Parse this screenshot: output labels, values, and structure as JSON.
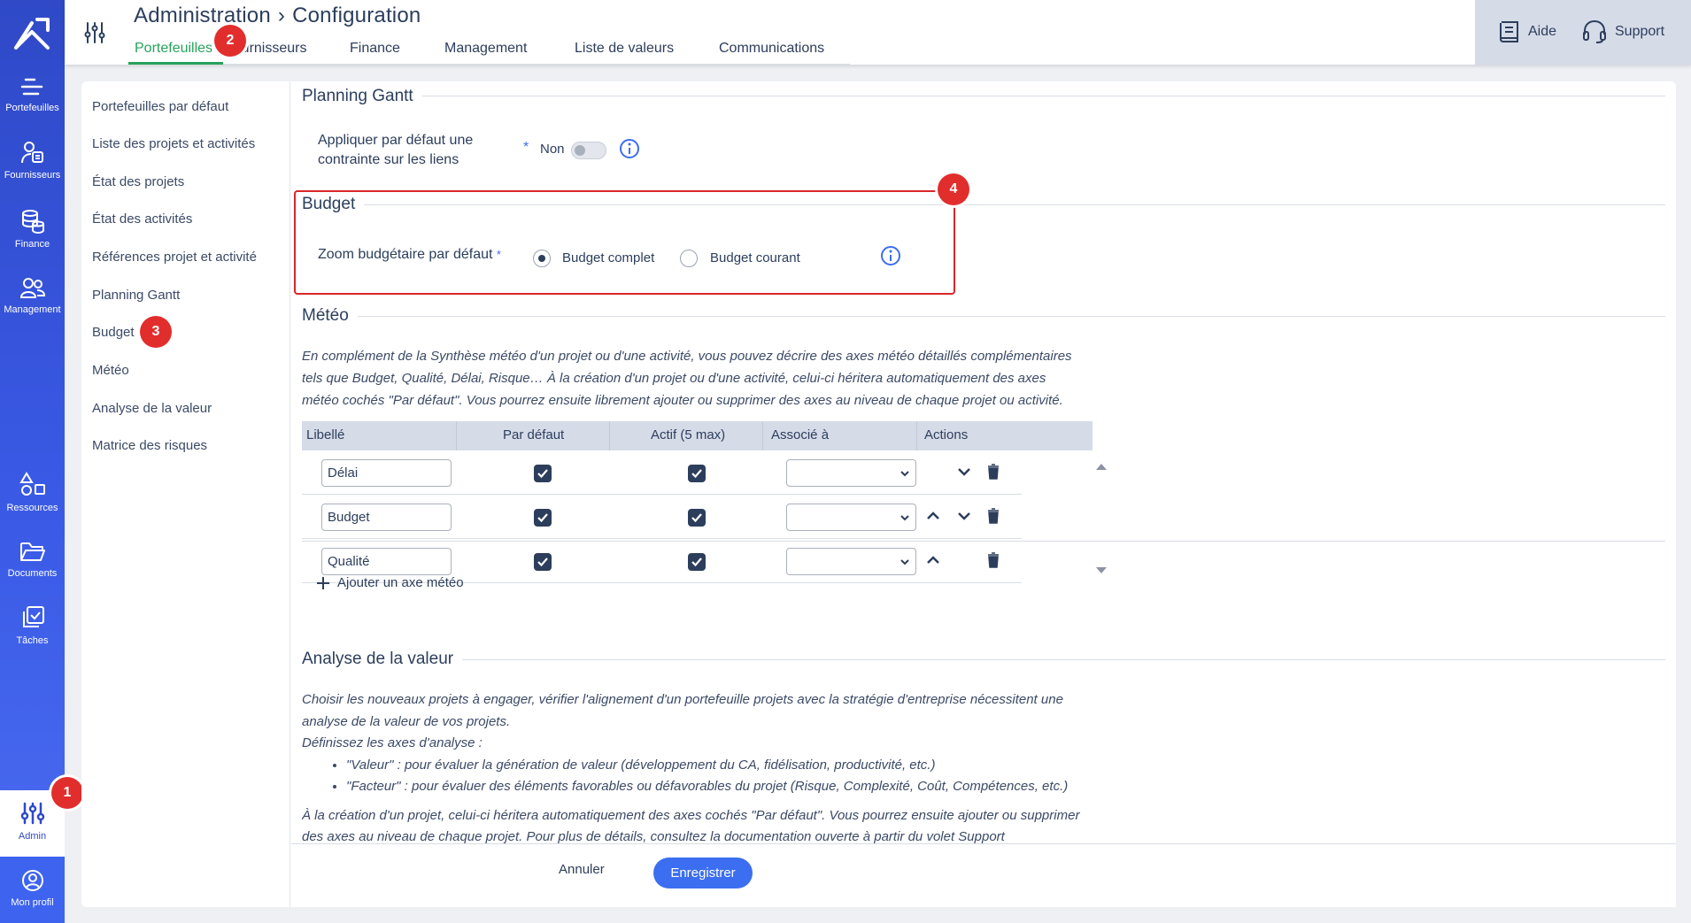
{
  "nav": {
    "items": [
      {
        "label": "Portefeuilles",
        "icon": "portfolio-icon"
      },
      {
        "label": "Fournisseurs",
        "icon": "suppliers-icon"
      },
      {
        "label": "Finance",
        "icon": "finance-icon"
      },
      {
        "label": "Management",
        "icon": "management-icon"
      },
      {
        "label": "Ressources",
        "icon": "resources-icon"
      },
      {
        "label": "Documents",
        "icon": "documents-icon"
      },
      {
        "label": "Tâches",
        "icon": "tasks-icon"
      }
    ],
    "admin_label": "Admin",
    "profile_label": "Mon profil"
  },
  "header": {
    "crumb_root": "Administration",
    "crumb_sep": "›",
    "crumb_current": "Configuration",
    "tabs": [
      "Portefeuilles",
      "Fournisseurs",
      "Finance",
      "Management",
      "Liste de valeurs",
      "Communications"
    ],
    "active_tab": "Portefeuilles",
    "help_label": "Aide",
    "support_label": "Support"
  },
  "subnav": {
    "items": [
      "Portefeuilles par défaut",
      "Liste des projets et activités",
      "État des projets",
      "État des activités",
      "Références projet et activité",
      "Planning Gantt",
      "Budget",
      "Météo",
      "Analyse de la valeur",
      "Matrice des risques"
    ],
    "selected": "Budget"
  },
  "gantt": {
    "title": "Planning Gantt",
    "label_line1": "Appliquer par défaut une",
    "label_line2": "contrainte sur les liens",
    "required_mark": "*",
    "toggle_label": "Non"
  },
  "budget": {
    "title": "Budget",
    "label": "Zoom budgétaire par défaut",
    "required_mark": "*",
    "option_full": "Budget complet",
    "option_current": "Budget courant",
    "selected": "Budget complet"
  },
  "meteo": {
    "title": "Météo",
    "desc_line1": "En complément de la Synthèse météo d'un projet ou d'une activité, vous pouvez décrire des axes météo détaillés complémentaires",
    "desc_line2": "tels que Budget, Qualité, Délai, Risque… À la création d'un projet ou d'une activité, celui-ci héritera automatiquement des axes",
    "desc_line3": "météo cochés \"Par défaut\". Vous pourrez ensuite librement ajouter ou supprimer des axes au niveau de chaque projet ou activité.",
    "columns": [
      "Libellé",
      "Par défaut",
      "Actif (5 max)",
      "Associé à",
      "Actions"
    ],
    "rows": [
      {
        "label": "Délai",
        "default": true,
        "active": true,
        "associated": ""
      },
      {
        "label": "Budget",
        "default": true,
        "active": true,
        "associated": ""
      },
      {
        "label": "Qualité",
        "default": true,
        "active": true,
        "associated": ""
      }
    ],
    "add_label": "Ajouter un axe météo"
  },
  "value_analysis": {
    "title": "Analyse de la valeur",
    "desc_line1": "Choisir les nouveaux projets à engager, vérifier l'alignement d'un portefeuille projets avec la stratégie d'entreprise nécessitent une",
    "desc_line2": "analyse de la valeur de vos projets.",
    "desc_line3": "Définissez les axes d'analyse :",
    "bullet1": "\"Valeur\" : pour évaluer la génération de valeur (développement du CA, fidélisation, productivité, etc.)",
    "bullet2": "\"Facteur\" : pour évaluer des éléments favorables ou défavorables du projet (Risque, Complexité, Coût, Compétences, etc.)",
    "desc_line4": "À la création d'un projet, celui-ci héritera automatiquement des axes cochés \"Par défaut\". Vous pourrez ensuite ajouter ou supprimer",
    "desc_line5": "des axes au niveau de chaque projet. Pour plus de détails, consultez la documentation ouverte à partir du volet Support"
  },
  "footer": {
    "cancel_label": "Annuler",
    "save_label": "Enregistrer"
  },
  "badges": [
    "1",
    "2",
    "3",
    "4"
  ],
  "colors": {
    "accent_green": "#27a35b",
    "primary_blue": "#3b6ef0",
    "nav_blue": "#2f49c7",
    "badge_red": "#e22d2d"
  }
}
